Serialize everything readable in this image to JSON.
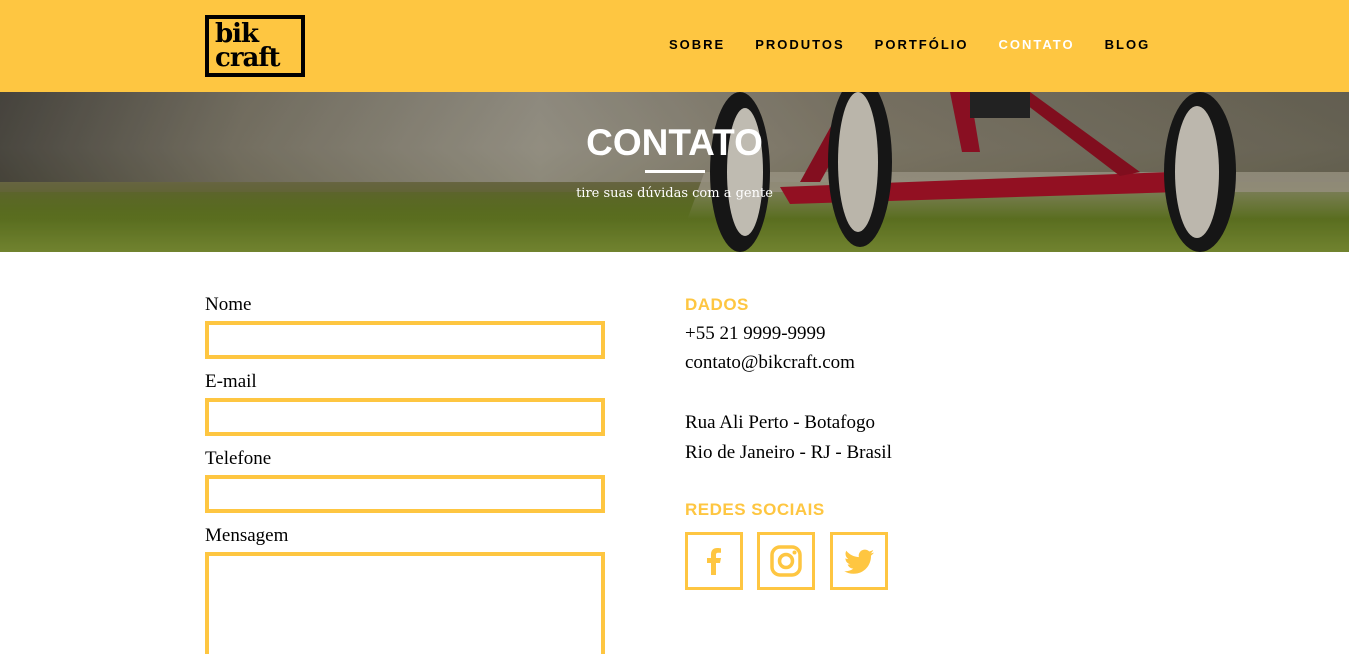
{
  "brand": {
    "logo_line1": "bik",
    "logo_line2": "craft"
  },
  "nav": {
    "items": [
      {
        "label": "SOBRE"
      },
      {
        "label": "PRODUTOS"
      },
      {
        "label": "PORTFÓLIO"
      },
      {
        "label": "CONTATO",
        "active": true
      },
      {
        "label": "BLOG"
      }
    ]
  },
  "hero": {
    "title": "CONTATO",
    "subtitle": "tire suas dúvidas com a gente"
  },
  "form": {
    "name_label": "Nome",
    "email_label": "E-mail",
    "phone_label": "Telefone",
    "message_label": "Mensagem"
  },
  "info": {
    "data_title": "DADOS",
    "phone": "+55 21 9999-9999",
    "email": "contato@bikcraft.com",
    "address_line1": "Rua Ali Perto - Botafogo",
    "address_line2": "Rio de Janeiro - RJ - Brasil",
    "social_title": "REDES SOCIAIS",
    "social": [
      "facebook-icon",
      "instagram-icon",
      "twitter-icon"
    ]
  },
  "colors": {
    "accent": "#FEC641",
    "text": "#000000",
    "white": "#FFFFFF"
  }
}
